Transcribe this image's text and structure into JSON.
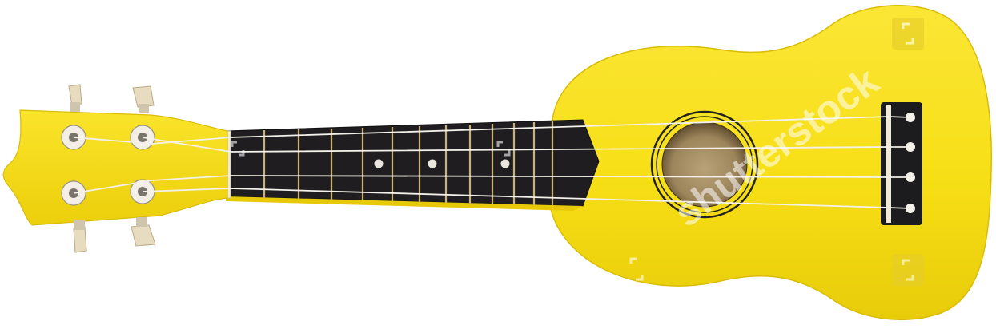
{
  "image": {
    "subject": "ukulele",
    "body_color": "#f7e01c",
    "fretboard_color": "#1f1d1f",
    "fret_color": "#c9b27a",
    "tuner_button_color": "#e8dcc0",
    "string_color": "#f4f1ea",
    "background": "#ffffff"
  },
  "watermark": {
    "text": "shutterstock",
    "color": "#ffffff"
  }
}
